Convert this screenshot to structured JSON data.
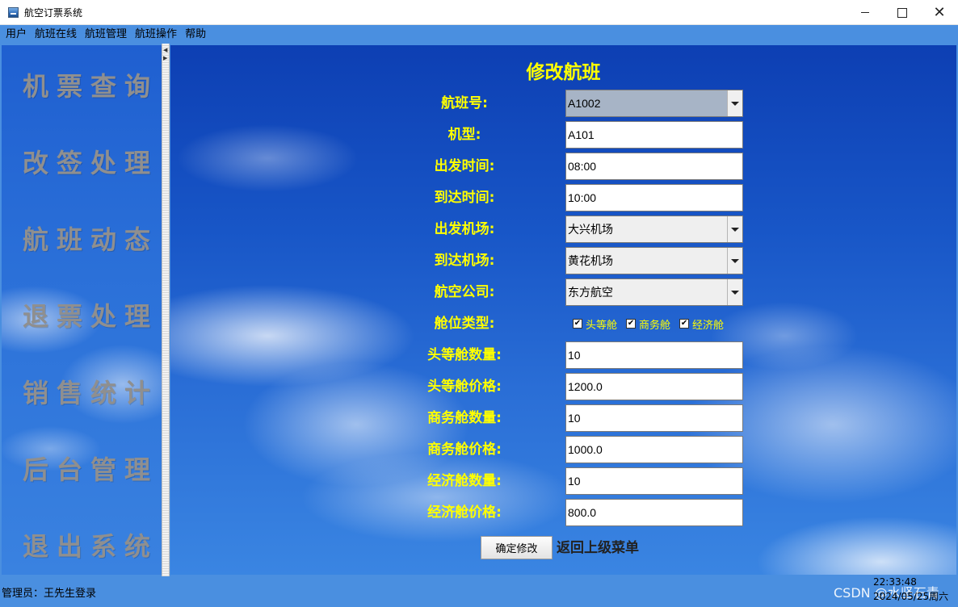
{
  "window": {
    "title": "航空订票系统"
  },
  "menu": [
    "用户",
    "航班在线",
    "航班管理",
    "航班操作",
    "帮助"
  ],
  "sidebar": {
    "items": [
      "机票查询",
      "改签处理",
      "航班动态",
      "退票处理",
      "销售统计",
      "后台管理",
      "退出系统"
    ]
  },
  "form": {
    "title": "修改航班",
    "flight_no_label": "航班号:",
    "flight_no_value": "A1002",
    "model_label": "机型:",
    "model_value": "A101",
    "depart_time_label": "出发时间:",
    "depart_time_value": "08:00",
    "arrive_time_label": "到达时间:",
    "arrive_time_value": "10:00",
    "depart_airport_label": "出发机场:",
    "depart_airport_value": "大兴机场",
    "arrive_airport_label": "到达机场:",
    "arrive_airport_value": "黄花机场",
    "airline_label": "航空公司:",
    "airline_value": "东方航空",
    "cabin_type_label": "舱位类型:",
    "cabins": [
      {
        "label": "头等舱",
        "checked": true
      },
      {
        "label": "商务舱",
        "checked": true
      },
      {
        "label": "经济舱",
        "checked": true
      }
    ],
    "first_qty_label": "头等舱数量:",
    "first_qty_value": "10",
    "first_price_label": "头等舱价格:",
    "first_price_value": "1200.0",
    "business_qty_label": "商务舱数量:",
    "business_qty_value": "10",
    "business_price_label": "商务舱价格:",
    "business_price_value": "1000.0",
    "economy_qty_label": "经济舱数量:",
    "economy_qty_value": "10",
    "economy_price_label": "经济舱价格:",
    "economy_price_value": "800.0",
    "confirm_button": "确定修改",
    "back_link": "返回上级菜单"
  },
  "status": {
    "user": "管理员：王先生登录",
    "time": "22:33:48",
    "date": "2024/05/25周六",
    "watermark": "CSDN @水坚石青"
  },
  "colors": {
    "accent_bar": "#4a8fe0",
    "label_yellow": "#ffff00",
    "sidebar_text": "#8f8f8f"
  }
}
